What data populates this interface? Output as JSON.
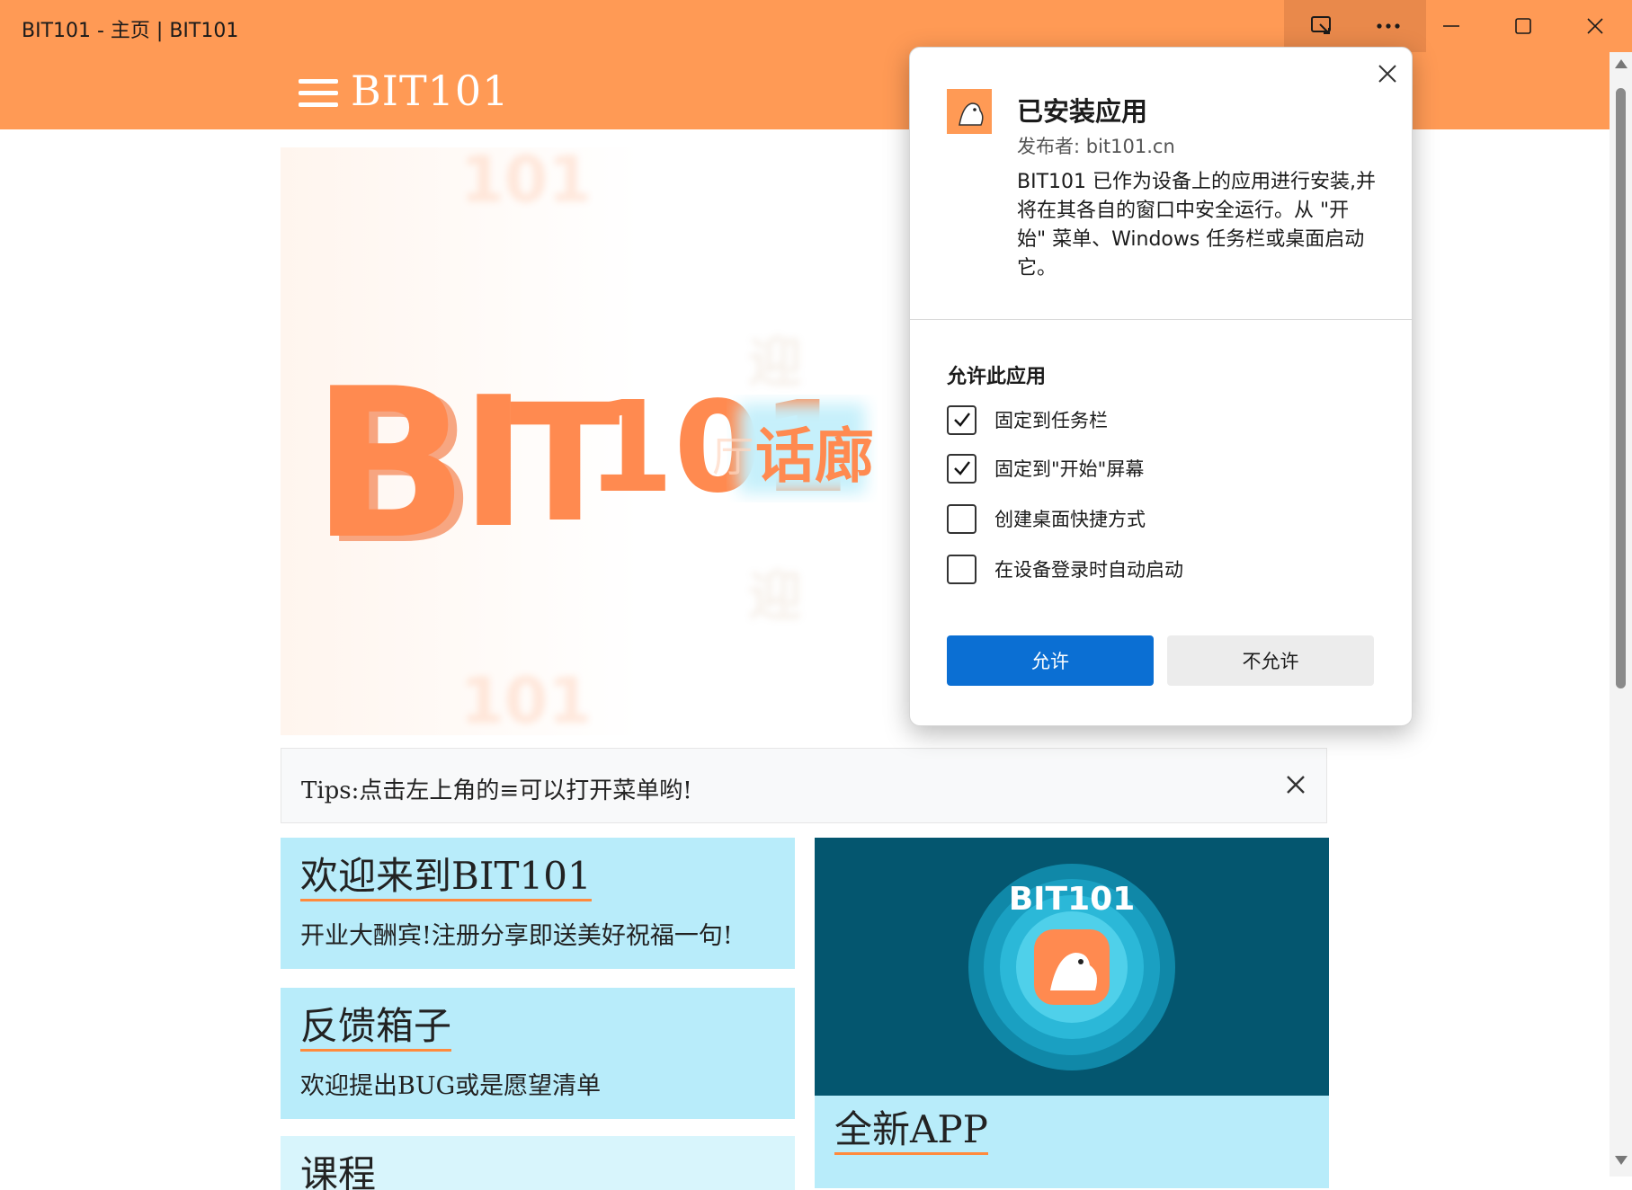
{
  "window": {
    "title": "BIT101 - 主页 | BIT101",
    "buttons": {
      "app_install": "app-available-icon",
      "more": "more-icon",
      "minimize": "minimize-icon",
      "maximize": "maximize-icon",
      "close": "close-icon"
    }
  },
  "appbar": {
    "menu_icon": "hamburger-icon",
    "title": "BIT101",
    "color": "#ff9a55"
  },
  "hero": {
    "logo_text": "BIT101",
    "feature_text": "话廊",
    "colors": {
      "orange": "#ff8a50",
      "cyan_glow": "#c6f0fb"
    }
  },
  "tips": {
    "text": "Tips:点击左上角的≡可以打开菜单哟!",
    "close_icon": "close-icon"
  },
  "cards": [
    {
      "title": "欢迎来到BIT101",
      "subtitle": "开业大酬宾!注册分享即送美好祝福一句!"
    },
    {
      "title": "反馈箱子",
      "subtitle": "欢迎提出BUG或是愿望清单"
    },
    {
      "title": "课程",
      "subtitle": ""
    }
  ],
  "app_card": {
    "banner_logo_text": "BIT101",
    "title": "全新APP",
    "banner_color": "#04566f"
  },
  "dialog": {
    "title": "已安装应用",
    "publisher": "发布者: bit101.cn",
    "description": "BIT101 已作为设备上的应用进行安装,并将在其各自的窗口中安全运行。从 \"开始\" 菜单、Windows 任务栏或桌面启动它。",
    "section_title": "允许此应用",
    "options": [
      {
        "label": "固定到任务栏",
        "checked": true
      },
      {
        "label": "固定到\"开始\"屏幕",
        "checked": true
      },
      {
        "label": "创建桌面快捷方式",
        "checked": false
      },
      {
        "label": "在设备登录时自动启动",
        "checked": false
      }
    ],
    "allow_label": "允许",
    "deny_label": "不允许",
    "accent": "#0b6fd3"
  }
}
